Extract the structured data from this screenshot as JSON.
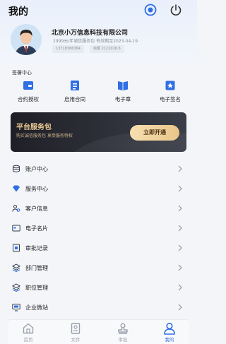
{
  "header": {
    "title": "我的"
  },
  "profile": {
    "company": "北京小万信息科技有限公司",
    "package": "2999元/年诚信服务包 有效期至2023-04-19",
    "phone": "13718366364",
    "balance": "余额 2122026.6"
  },
  "quick": {
    "section_title": "签署中心",
    "items": [
      {
        "label": "合约授权",
        "icon": "contract-auth-icon"
      },
      {
        "label": "启用合同",
        "icon": "enable-contract-icon"
      },
      {
        "label": "电子章",
        "icon": "e-seal-icon"
      },
      {
        "label": "电子签名",
        "icon": "e-signature-icon"
      }
    ]
  },
  "banner": {
    "title": "平台服务包",
    "subtitle": "购买诚信服务包 享受服务特权",
    "button": "立即开通"
  },
  "menu": [
    {
      "label": "账户中心",
      "icon": "account-icon"
    },
    {
      "label": "服务中心",
      "icon": "diamond-icon"
    },
    {
      "label": "客户信息",
      "icon": "users-icon"
    },
    {
      "label": "电子名片",
      "icon": "card-icon"
    },
    {
      "label": "审批记录",
      "icon": "record-icon"
    },
    {
      "label": "部门管理",
      "icon": "layers-icon"
    },
    {
      "label": "职位管理",
      "icon": "layers-icon"
    },
    {
      "label": "企业微站",
      "icon": "monitor-icon"
    }
  ],
  "tabs": [
    {
      "label": "首页",
      "icon": "home-icon",
      "active": false
    },
    {
      "label": "文件",
      "icon": "file-icon",
      "active": false
    },
    {
      "label": "审批",
      "icon": "stamp-icon",
      "active": false
    },
    {
      "label": "我的",
      "icon": "user-icon",
      "active": true
    }
  ],
  "colors": {
    "accent": "#2f6fe4",
    "banner_gold": "#e9c891",
    "banner_dark": "#1f1f27"
  }
}
